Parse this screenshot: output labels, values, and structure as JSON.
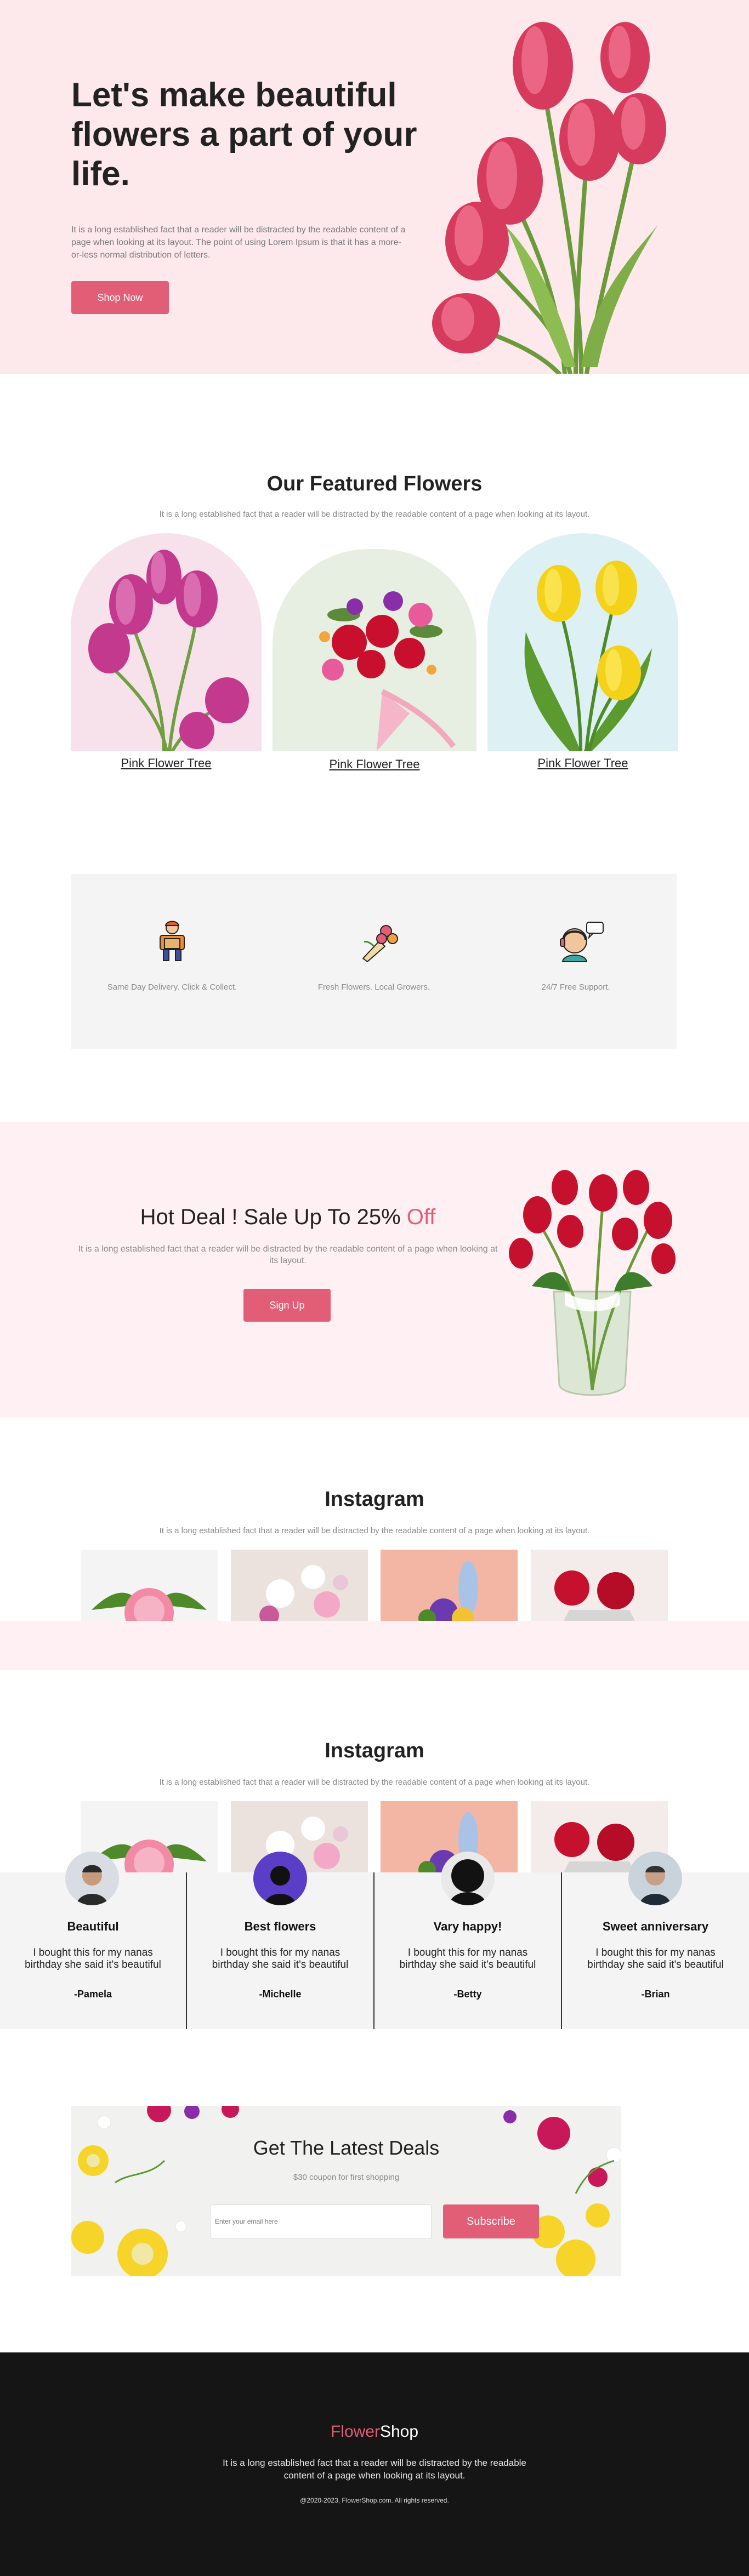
{
  "hero": {
    "title": "Let's make beautiful flowers a part of your life.",
    "description": "It is a long established fact that a reader will be distracted by the readable content of a page when looking at its layout. The point of using Lorem Ipsum is that it has a more-or-less normal distribution of letters.",
    "cta_label": "Shop Now"
  },
  "featured": {
    "title": "Our Featured Flowers",
    "subtitle": "It is a long established fact that a reader will be distracted by the readable content of a page when looking at its layout.",
    "cards": [
      {
        "label": "Pink Flower Tree",
        "bg": "#f7e2ec"
      },
      {
        "label": "Pink Flower Tree",
        "bg": "#e6efe2"
      },
      {
        "label": "Pink Flower Tree",
        "bg": "#ddf0f3"
      }
    ]
  },
  "features": [
    {
      "icon": "delivery-person-icon",
      "label": "Same Day Delivery. Click & Collect."
    },
    {
      "icon": "flower-bouquet-icon",
      "label": "Fresh Flowers. Local Growers."
    },
    {
      "icon": "support-agent-icon",
      "label": "24/7 Free Support."
    }
  ],
  "deal": {
    "title_main": "Hot Deal ! Sale Up To 25%",
    "title_accent": "Off",
    "description": "It is a long established fact that a reader will be distracted by the readable content of a page when looking at its layout.",
    "cta_label": "Sign Up"
  },
  "instagram_1": {
    "title": "Instagram",
    "subtitle": "It is a long established fact that a reader will be distracted by the readable content of a page when looking at its layout."
  },
  "instagram_2": {
    "title": "Instagram",
    "subtitle": "It is a long established fact that a reader will be distracted by the readable content of a page when looking at its layout."
  },
  "testimonials": [
    {
      "title": "Beautiful",
      "body": "I bought this for my nanas birthday she said it's beautiful",
      "name": "-Pamela"
    },
    {
      "title": "Best flowers",
      "body": "I bought this for my nanas birthday she said it's beautiful",
      "name": "-Michelle"
    },
    {
      "title": "Vary happy!",
      "body": "I bought this for my nanas birthday she said it's beautiful",
      "name": "-Betty"
    },
    {
      "title": "Sweet anniversary",
      "body": "I bought this for my nanas birthday she said it's beautiful",
      "name": "-Brian"
    }
  ],
  "newsletter": {
    "title": "Get The Latest Deals",
    "subtitle": "$30 coupon for first shopping",
    "email_placeholder": "Enter your email here",
    "cta_label": "Subscribe"
  },
  "footer": {
    "brand_accent": "Flower",
    "brand_main": "Shop",
    "description": "It is a long established fact that a reader will be distracted by the readable content of a page when looking at its layout.",
    "copyright": "@2020-2023, FlowerShop.com. All rights reserved."
  },
  "colors": {
    "accent": "#e15e76",
    "hero_bg": "#fde8ec",
    "footer_bg": "#151515"
  }
}
